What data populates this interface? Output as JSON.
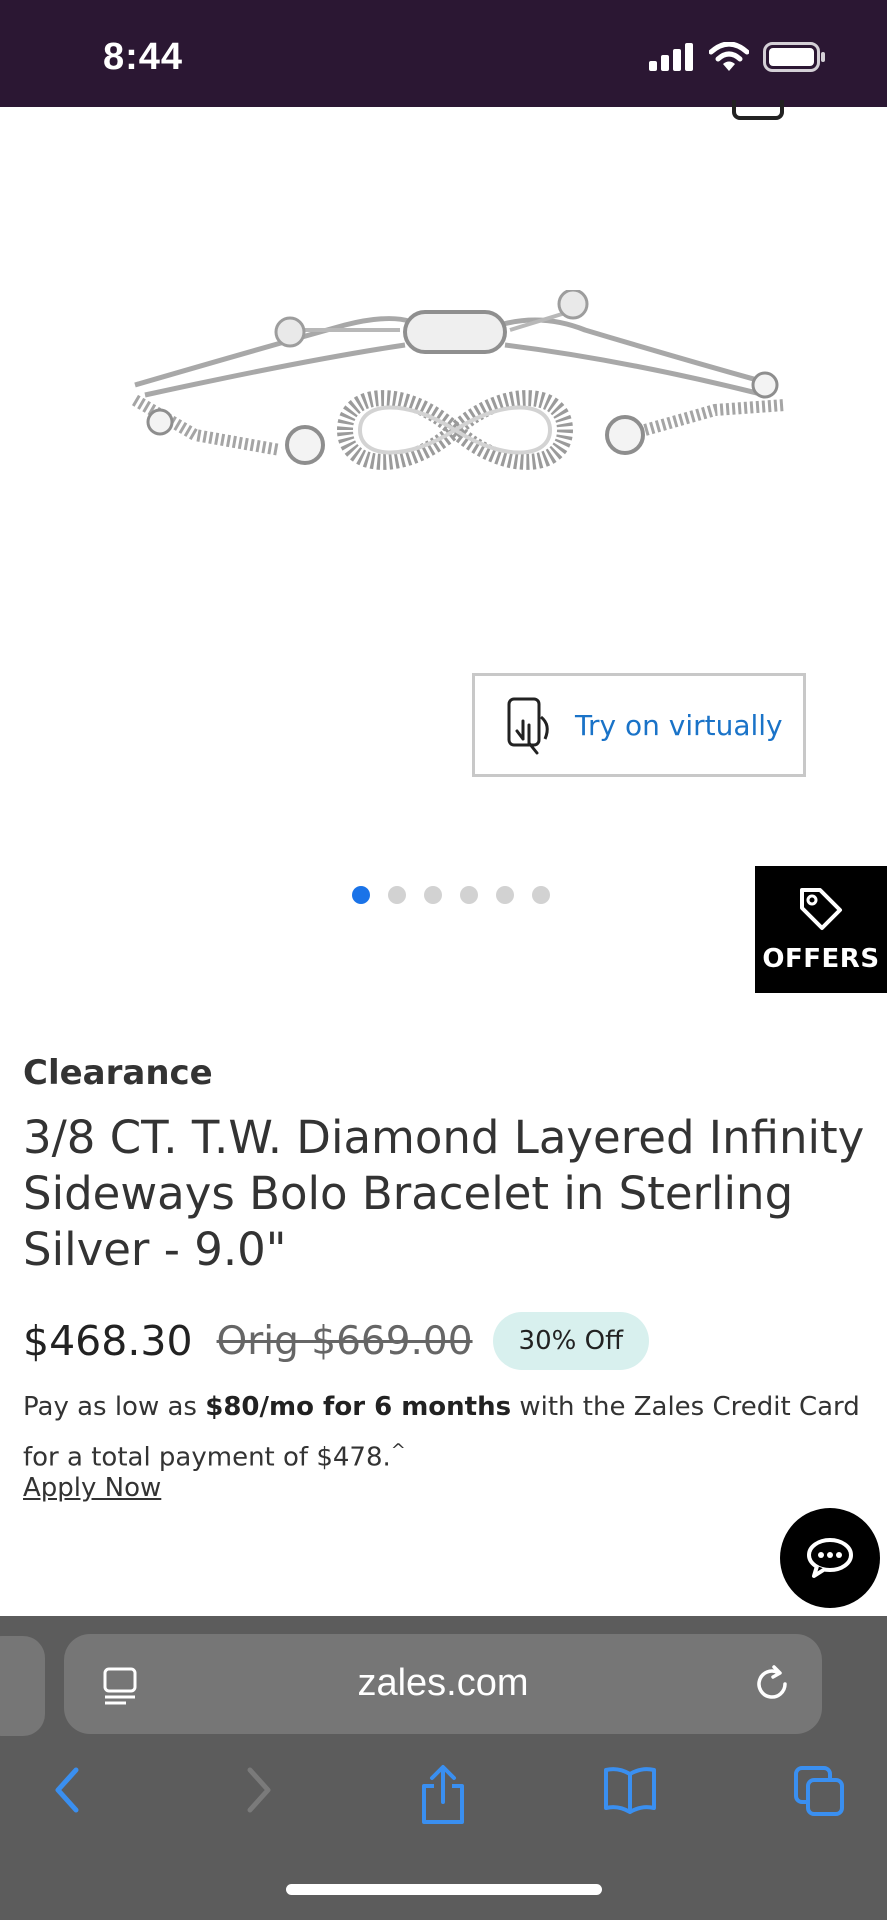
{
  "status": {
    "time": "8:44"
  },
  "try_on": {
    "label": "Try on virtually"
  },
  "carousel": {
    "total": 6,
    "active": 1
  },
  "offers": {
    "label": "OFFERS"
  },
  "product": {
    "badge": "Clearance",
    "title": "3/8 CT. T.W. Diamond Layered Infinity Sideways Bolo Bracelet in Sterling Silver - 9.0\"",
    "price": "$468.30",
    "orig_price": "Orig $669.00",
    "discount": "30% Off"
  },
  "financing": {
    "prefix": "Pay as low as ",
    "bold": "$80/mo for 6 months",
    "suffix": " with the Zales Credit Card for a total payment of $478.",
    "mark": "^",
    "apply_label": "Apply Now"
  },
  "browser": {
    "url": "zales.com"
  },
  "colors": {
    "status_bar": "#2b1733",
    "link_blue": "#1a73c8",
    "dot_active": "#1a73e8",
    "badge_bg": "#d8f0ee"
  }
}
